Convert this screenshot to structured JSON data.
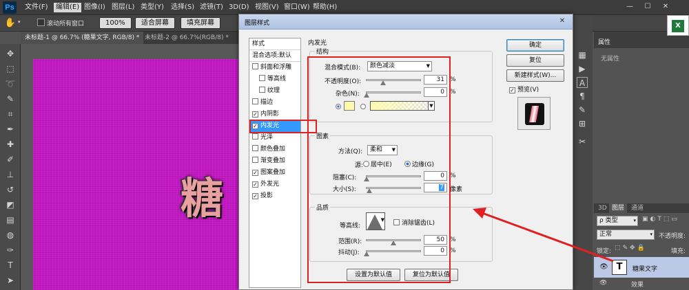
{
  "app": {
    "logo": "Ps",
    "menus": [
      "文件(F)",
      "编辑(E)",
      "图像(I)",
      "图层(L)",
      "类型(Y)",
      "选择(S)",
      "滤镜(T)",
      "3D(D)",
      "视图(V)",
      "窗口(W)",
      "帮助(H)"
    ],
    "active_menu_index": 1,
    "window_buttons": [
      "—",
      "☐",
      "✕"
    ]
  },
  "options_bar": {
    "scroll_all_label": "滚动所有窗口",
    "zoom_100": "100%",
    "fit_screen": "适合屏幕",
    "fill_screen": "填充屏幕"
  },
  "doc_tabs": [
    {
      "label": "未标题-1 @ 66.7% (糖果文字, RGB/8) *"
    },
    {
      "label": "未标题-2 @ 66.7%(RGB/8) *"
    }
  ],
  "canvas": {
    "text": "糖",
    "bg_color": "#c619c6"
  },
  "dialog": {
    "title": "图层样式",
    "close": "✕",
    "styles": [
      {
        "label": "样式",
        "checkbox": false,
        "checked": false,
        "indent": 0
      },
      {
        "label": "混合选项:默认",
        "checkbox": false,
        "checked": false,
        "indent": 0
      },
      {
        "label": "斜面和浮雕",
        "checkbox": true,
        "checked": false,
        "indent": 0
      },
      {
        "label": "等高线",
        "checkbox": true,
        "checked": false,
        "indent": 1
      },
      {
        "label": "纹理",
        "checkbox": true,
        "checked": false,
        "indent": 1
      },
      {
        "label": "描边",
        "checkbox": true,
        "checked": false,
        "indent": 0
      },
      {
        "label": "内阴影",
        "checkbox": true,
        "checked": true,
        "indent": 0
      },
      {
        "label": "内发光",
        "checkbox": true,
        "checked": true,
        "indent": 0,
        "selected": true
      },
      {
        "label": "光泽",
        "checkbox": true,
        "checked": false,
        "indent": 0
      },
      {
        "label": "颜色叠加",
        "checkbox": true,
        "checked": false,
        "indent": 0
      },
      {
        "label": "渐变叠加",
        "checkbox": true,
        "checked": false,
        "indent": 0
      },
      {
        "label": "图案叠加",
        "checkbox": true,
        "checked": true,
        "indent": 0
      },
      {
        "label": "外发光",
        "checkbox": true,
        "checked": true,
        "indent": 0
      },
      {
        "label": "投影",
        "checkbox": true,
        "checked": true,
        "indent": 0
      }
    ],
    "section_title": "内发光",
    "structure": {
      "title": "结构",
      "blend_mode_label": "混合模式(B):",
      "blend_mode_value": "颜色减淡",
      "opacity_label": "不透明度(O):",
      "opacity_value": "31",
      "opacity_unit": "%",
      "opacity_fraction": 0.31,
      "noise_label": "杂色(N):",
      "noise_value": "0",
      "noise_unit": "%",
      "glow_color": "#fdfab0"
    },
    "elements": {
      "title": "图素",
      "technique_label": "方法(Q):",
      "technique_value": "柔和",
      "source_label": "源:",
      "source_center": "居中(E)",
      "source_edge": "边缘(G)",
      "choke_label": "阻塞(C):",
      "choke_value": "0",
      "choke_unit": "%",
      "size_label": "大小(S):",
      "size_value": "7",
      "size_unit": "像素"
    },
    "quality": {
      "title": "品质",
      "contour_label": "等高线:",
      "antialias_label": "消除锯齿(L)",
      "range_label": "范围(R):",
      "range_value": "50",
      "range_unit": "%",
      "jitter_label": "抖动(J):",
      "jitter_value": "0",
      "jitter_unit": "%"
    },
    "make_default": "设置为默认值",
    "reset_default": "复位为默认值",
    "ok": "确定",
    "reset": "复位",
    "new_style": "新建样式(W)...",
    "preview_label": "预览(V)"
  },
  "right_panels": {
    "properties_tab": "属性",
    "no_properties": "无属性",
    "layers_tabs": [
      "3D",
      "图层",
      "通道"
    ],
    "kind_label": "ρ 类型",
    "blend_normal": "正常",
    "opacity_label": "不透明度:",
    "lock_label": "锁定:",
    "fill_label": "填充:",
    "layer_name": "糖果文字",
    "effects_label": "效果"
  },
  "colors": {
    "red_annotation": "#e02020",
    "selection_blue": "#3399ff"
  }
}
